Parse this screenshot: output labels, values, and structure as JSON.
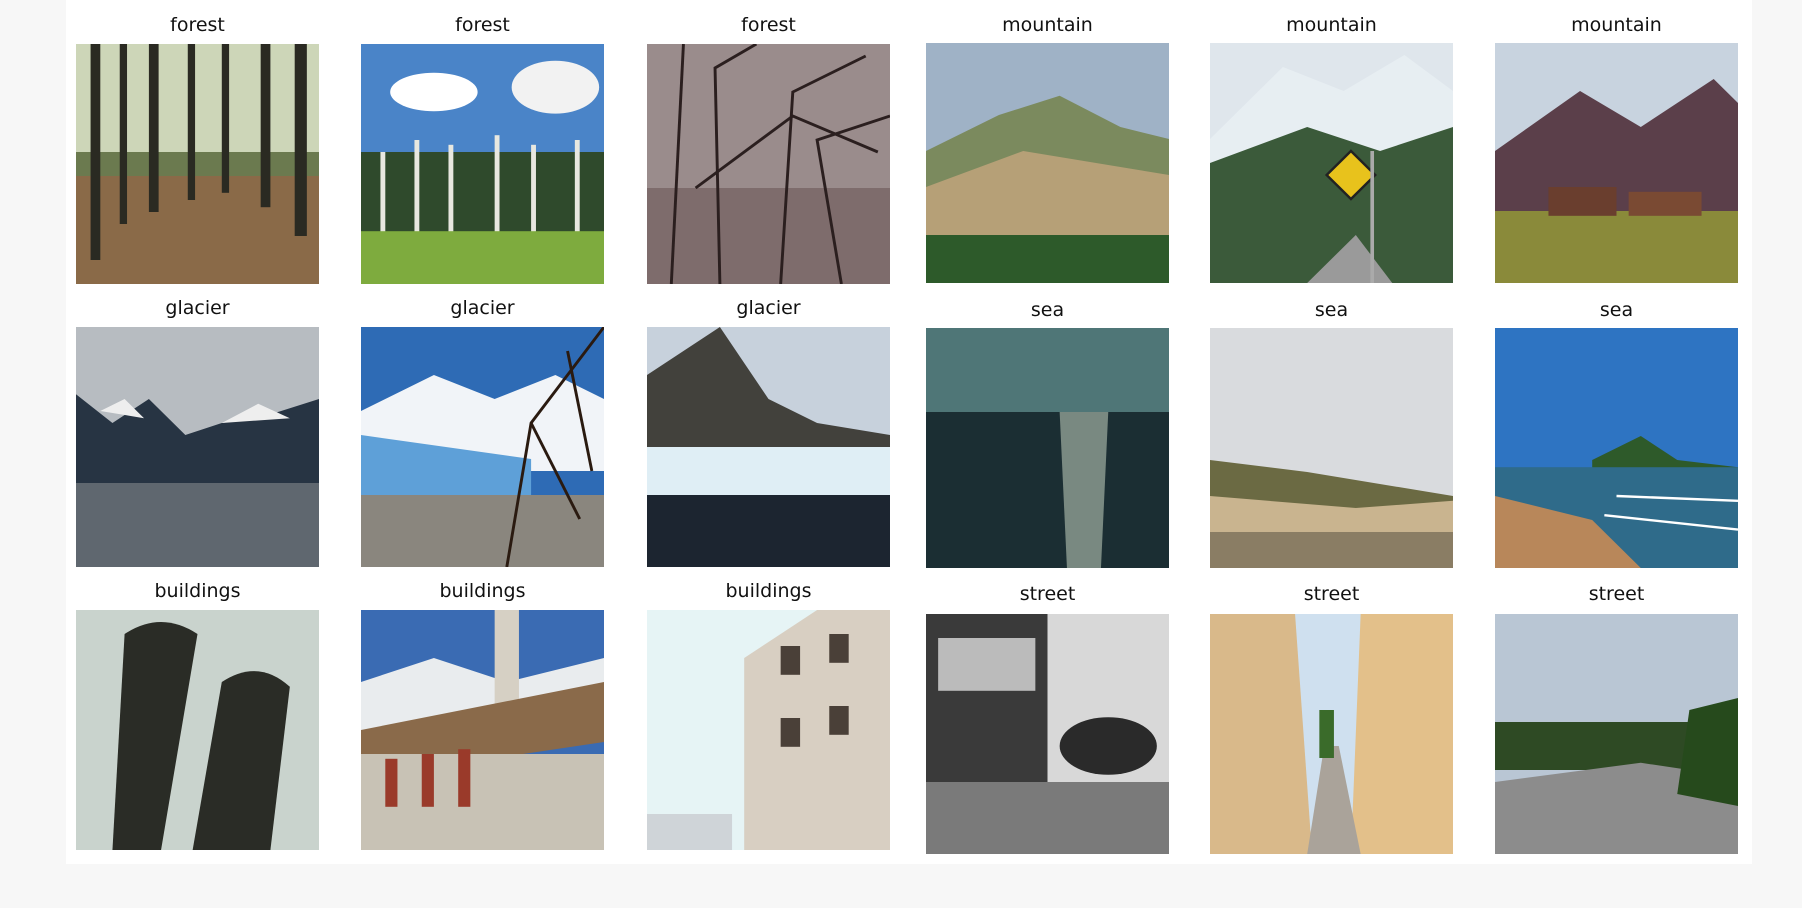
{
  "grid": {
    "rows": [
      [
        {
          "label": "forest",
          "image": "forest trees with sunlight on path"
        },
        {
          "label": "forest",
          "image": "tall aspen trees under blue sky with clouds"
        },
        {
          "label": "forest",
          "image": "dark misty forest with bare branches"
        },
        {
          "label": "mountain",
          "image": "green and brown mountain range"
        },
        {
          "label": "mountain",
          "image": "snowy peak with animal crossing road sign"
        },
        {
          "label": "mountain",
          "image": "mountain valley with barns"
        }
      ],
      [
        {
          "label": "glacier",
          "image": "lake with snowy mountains"
        },
        {
          "label": "glacier",
          "image": "blue glacier with bare tree branches"
        },
        {
          "label": "glacier",
          "image": "glacier wall with mountain peak"
        },
        {
          "label": "sea",
          "image": "dark sea with sunlight reflection"
        },
        {
          "label": "sea",
          "image": "cloudy sky over beach and rocks"
        },
        {
          "label": "sea",
          "image": "blue sea bay with waves and town"
        }
      ],
      [
        {
          "label": "buildings",
          "image": "two corncob towers"
        },
        {
          "label": "buildings",
          "image": "stone building with red arches and snowy mountains"
        },
        {
          "label": "buildings",
          "image": "ornate building with balconies"
        },
        {
          "label": "street",
          "image": "black and white street corner"
        },
        {
          "label": "street",
          "image": "narrow street with colorful houses"
        },
        {
          "label": "street",
          "image": "road curving past trees"
        }
      ]
    ]
  }
}
